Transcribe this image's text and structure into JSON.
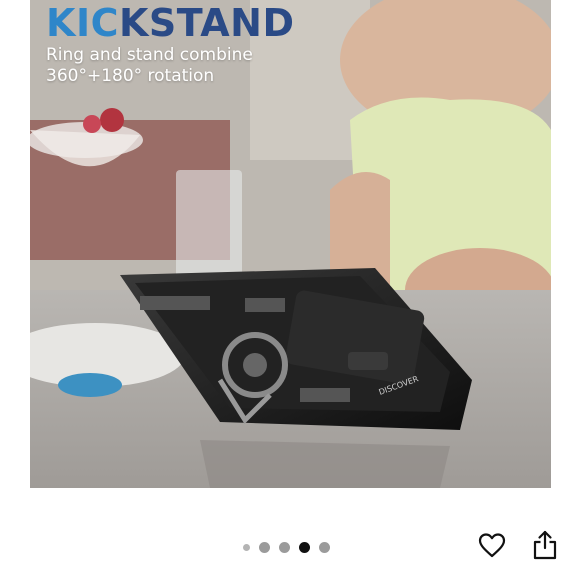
{
  "banner": {
    "headline_accent": "KIC",
    "headline_main": "KSTAND",
    "line1": "Ring and stand combine",
    "line2": "360°+180° rotation",
    "accent_color": "#2f86c9",
    "headline_color": "#2a4a86"
  },
  "case_print": "DISCOVER",
  "carousel": {
    "total_images": 5,
    "active_index": 3
  },
  "actions": {
    "favorite_icon": "heart-icon",
    "share_icon": "share-icon"
  }
}
